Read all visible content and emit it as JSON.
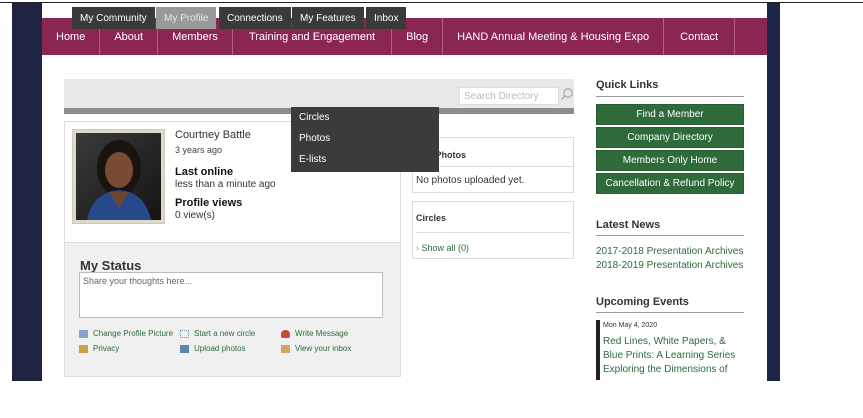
{
  "nav": {
    "items": [
      "Home",
      "About",
      "Members",
      "Training and Engagement",
      "Blog",
      "HAND Annual Meeting & Housing Expo",
      "Contact"
    ]
  },
  "tabs": [
    "My Community",
    "My Profile",
    "Connections",
    "My Features",
    "Inbox"
  ],
  "search": {
    "placeholder": "Search Directory"
  },
  "dropdown": [
    "Circles",
    "Photos",
    "E-lists"
  ],
  "profile": {
    "name": "Courtney Battle",
    "joined": "3 years ago",
    "last_online_label": "Last online",
    "last_online_value": "less than a minute ago",
    "views_label": "Profile views",
    "views_value": "0 view(s)"
  },
  "status": {
    "title": "My Status",
    "placeholder": "Share your thoughts here...",
    "actions": [
      "Change Profile Picture",
      "Start a new circle",
      "Write Message",
      "Privacy",
      "Upload photos",
      "View your inbox"
    ]
  },
  "photos_box": {
    "title": "t Photos",
    "text": "No photos uploaded yet."
  },
  "circles_box": {
    "title": "Circles",
    "link": "Show all (0)"
  },
  "quick_links": {
    "title": "Quick Links",
    "buttons": [
      "Find a Member",
      "Company Directory",
      "Members Only Home",
      "Cancellation & Refund Policy"
    ]
  },
  "latest_news": {
    "title": "Latest News",
    "items": [
      "2017-2018 Presentation Archives",
      "2018-2019 Presentation Archives"
    ]
  },
  "upcoming_events": {
    "title": "Upcoming Events",
    "date": "Mon May 4, 2020",
    "event": "Red Lines, White Papers, & Blue Prints: A Learning Series Exploring the Dimensions of"
  },
  "colors": {
    "brand": "#8b2652",
    "green": "#2f6a3a",
    "link": "#2d6b3b"
  }
}
